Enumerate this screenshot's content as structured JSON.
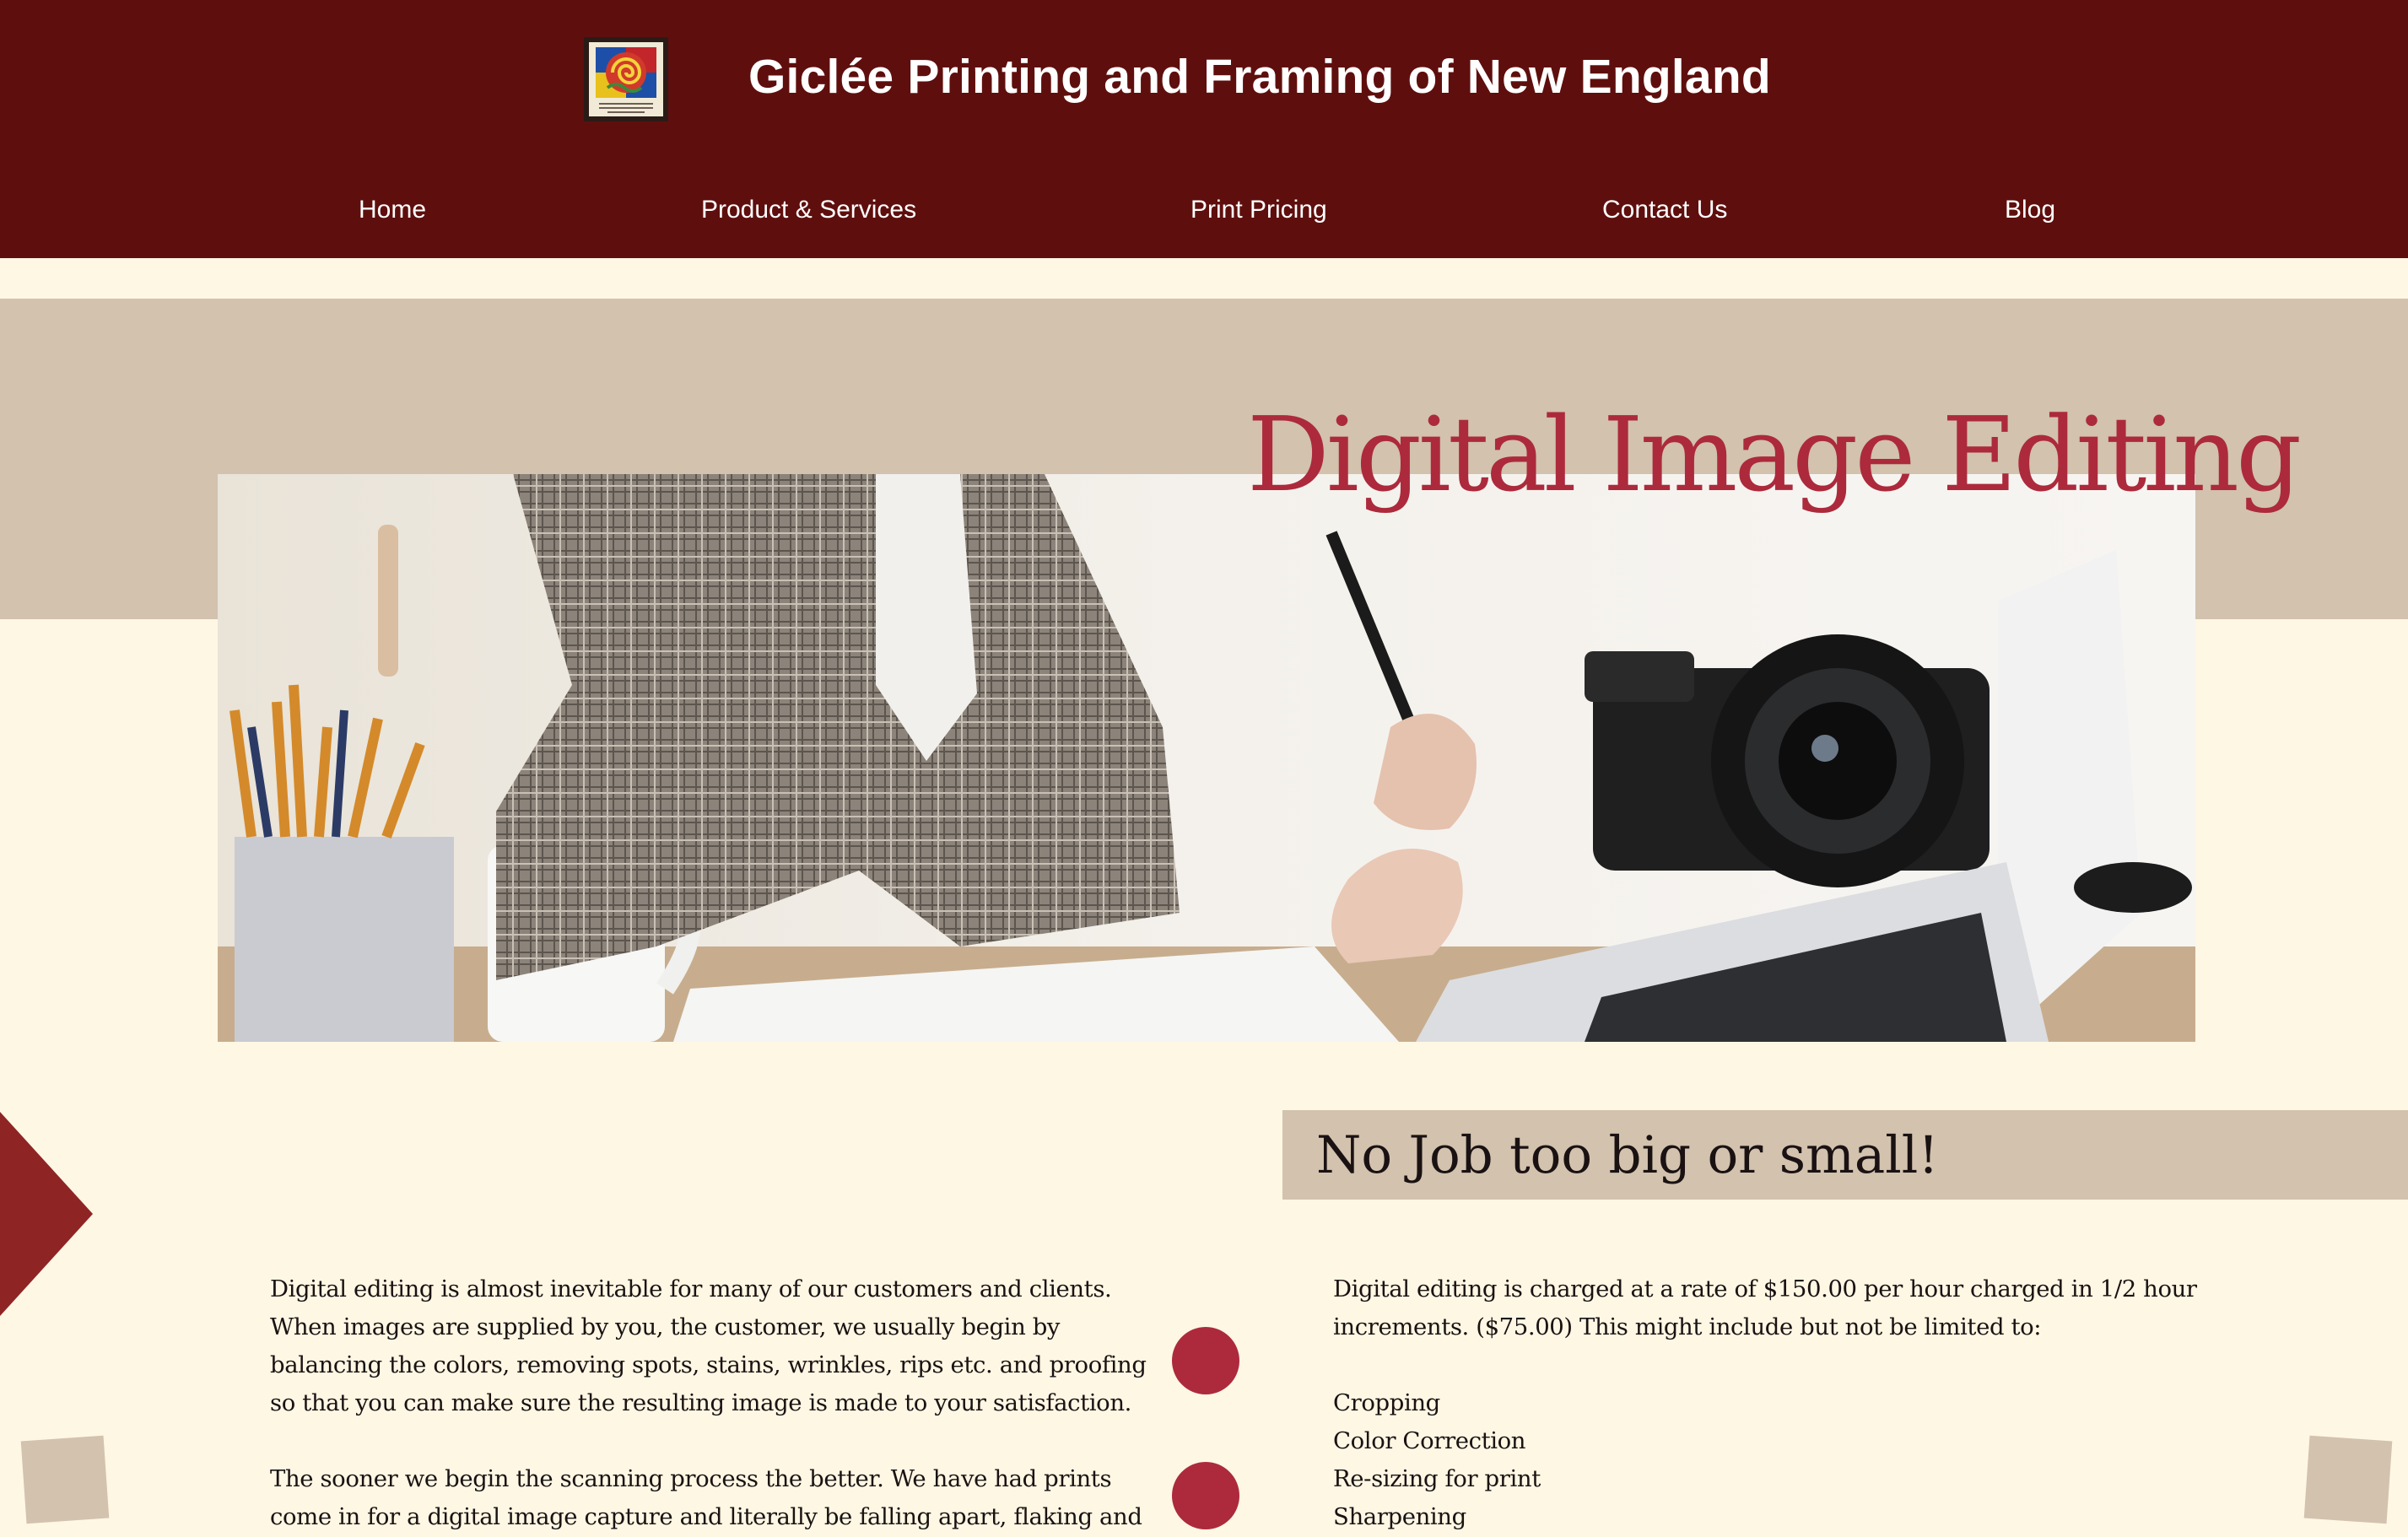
{
  "header": {
    "site_title": "Giclée Printing and Framing of New England",
    "logo_icon": "gallery-logo-icon"
  },
  "nav": {
    "items": [
      {
        "label": "Home"
      },
      {
        "label": "Product & Services"
      },
      {
        "label": "Print Pricing"
      },
      {
        "label": "Contact Us"
      },
      {
        "label": "Blog"
      }
    ]
  },
  "hero": {
    "title": "Digital Image Editing",
    "image": "woman-editing-photos-laptop-camera"
  },
  "left_column": {
    "paragraph1_lines": [
      "Digital editing is almost inevitable for many of our customers and clients.",
      "When images are supplied by you, the customer, we usually begin by",
      "balancing the colors, removing spots, stains, wrinkles, rips etc. and proofing",
      "so that you can make sure the resulting image is made to your satisfaction."
    ],
    "paragraph2_lines": [
      "The sooner we begin the scanning process the better. We have had prints",
      "come in for a digital image capture and literally be falling apart, flaking and"
    ]
  },
  "right_column": {
    "heading": "No Job too big or small!",
    "intro_lines": [
      "Digital editing is charged at a rate of $150.00 per hour charged in 1/2 hour",
      "increments. ($75.00) This might include but not be limited to:"
    ],
    "services": [
      "Cropping",
      "Color Correction",
      "Re-sizing for print",
      "Sharpening"
    ]
  },
  "colors": {
    "header_bg": "#5e0f0d",
    "page_bg": "#fdf7e4",
    "band_bg": "#d2c2ae",
    "accent": "#ac2a3c"
  }
}
